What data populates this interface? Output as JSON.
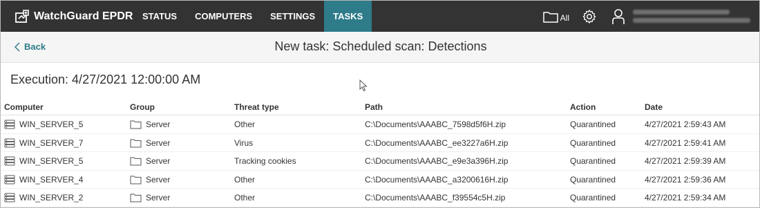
{
  "navbar": {
    "brand": "WatchGuard EPDR",
    "tabs": [
      {
        "label": "STATUS",
        "active": false
      },
      {
        "label": "COMPUTERS",
        "active": false
      },
      {
        "label": "SETTINGS",
        "active": false
      },
      {
        "label": "TASKS",
        "active": true
      }
    ],
    "folder_label": "All",
    "colors": {
      "background": "#333333",
      "active_tab": "#2e7b8a"
    }
  },
  "header": {
    "back_label": "Back",
    "title": "New task: Scheduled scan: Detections"
  },
  "execution": "Execution: 4/27/2021 12:00:00 AM",
  "table": {
    "columns": [
      "Computer",
      "Group",
      "Threat type",
      "Path",
      "Action",
      "Date"
    ],
    "rows": [
      {
        "computer": "WIN_SERVER_5",
        "group": "Server",
        "threat": "Other",
        "path": "C:\\Documents\\AAABC_7598d5f6H.zip",
        "action": "Quarantined",
        "date": "4/27/2021 2:59:43 AM"
      },
      {
        "computer": "WIN_SERVER_7",
        "group": "Server",
        "threat": "Virus",
        "path": "C:\\Documents\\AAABC_ee3227a6H.zip",
        "action": "Quarantined",
        "date": "4/27/2021 2:59:41 AM"
      },
      {
        "computer": "WIN_SERVER_5",
        "group": "Server",
        "threat": "Tracking cookies",
        "path": "C:\\Documents\\AAABC_e9e3a396H.zip",
        "action": "Quarantined",
        "date": "4/27/2021 2:59:39 AM"
      },
      {
        "computer": "WIN_SERVER_4",
        "group": "Server",
        "threat": "Other",
        "path": "C:\\Documents\\AAABC_a3200616H.zip",
        "action": "Quarantined",
        "date": "4/27/2021 2:59:36 AM"
      },
      {
        "computer": "WIN_SERVER_2",
        "group": "Server",
        "threat": "Other",
        "path": "C:\\Documents\\AAABC_f39554c5H.zip",
        "action": "Quarantined",
        "date": "4/27/2021 2:59:34 AM"
      }
    ]
  }
}
